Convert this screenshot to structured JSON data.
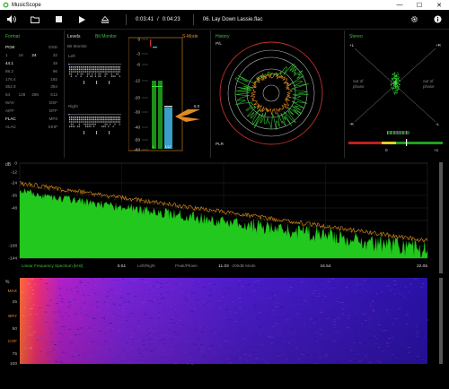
{
  "window": {
    "title": "MusicScope",
    "minimize": "—",
    "maximize": "☐",
    "close": "✕"
  },
  "toolbar": {
    "time_elapsed": "0:03:41",
    "time_sep": "/",
    "time_total": "0:04:23",
    "track": "06. Lay Down Lassie.flac"
  },
  "format": {
    "title": "Format",
    "rows": [
      [
        "PCM",
        "",
        "",
        "DSD"
      ],
      [
        "1",
        "16",
        "24",
        "32"
      ],
      [
        "44.1",
        "",
        "",
        "48"
      ],
      [
        "88.2",
        "",
        "",
        "96"
      ],
      [
        "176.4",
        "",
        "",
        "192"
      ],
      [
        "352.8",
        "",
        "",
        "384"
      ],
      [
        "64",
        "128",
        "256",
        "512"
      ],
      [
        "WAV",
        "",
        "",
        "DSF"
      ],
      [
        "AIFF",
        "",
        "",
        "DFF"
      ],
      [
        "FLAC",
        "",
        "",
        "MP3"
      ],
      [
        "ALAC",
        "",
        "",
        "SKIP"
      ]
    ]
  },
  "levels": {
    "title": "Levels",
    "bit_monitor": "Bit Monitor",
    "bit_monitor_sub": "Bit Monitor",
    "left": "Left",
    "right": "Right",
    "smode": "S-Mode",
    "scale": [
      "0",
      "-3",
      "-6",
      "-12",
      "-20",
      "-30",
      "-40",
      "-50",
      "-60"
    ],
    "bar_L": "L",
    "bar_LU": "LU",
    "peak_readout": "6.0"
  },
  "history": {
    "title": "History",
    "pl": "P/L",
    "plr": "PLR"
  },
  "stereo": {
    "title": "Stereo",
    "plus_l": "+L",
    "plus_r": "+R",
    "minus_r": "-R",
    "minus_l": "-L",
    "out_left": "out of\nphase",
    "out_right": "out of\nphase",
    "corr_zero": "0",
    "corr_plus": "+1"
  },
  "spectrum": {
    "db_label": "dB",
    "y_ticks": [
      "0",
      "-12",
      "-24",
      "-36",
      "-48",
      "-60",
      "-72",
      "-84",
      "-96",
      "-108",
      "-120",
      "-144"
    ],
    "x_ticks": [
      "5.51",
      "11.03",
      "16.54",
      "22.05"
    ],
    "footer": [
      "Linear Frequency Spectrum [kHz]",
      "Left/Right",
      "Peak/Phase",
      "-200dB Mode"
    ]
  },
  "spectrogram": {
    "pct_label": "%",
    "y_ticks": [
      "MAX",
      "25",
      "BRY",
      "50",
      "CGF",
      "75",
      "100"
    ]
  }
}
